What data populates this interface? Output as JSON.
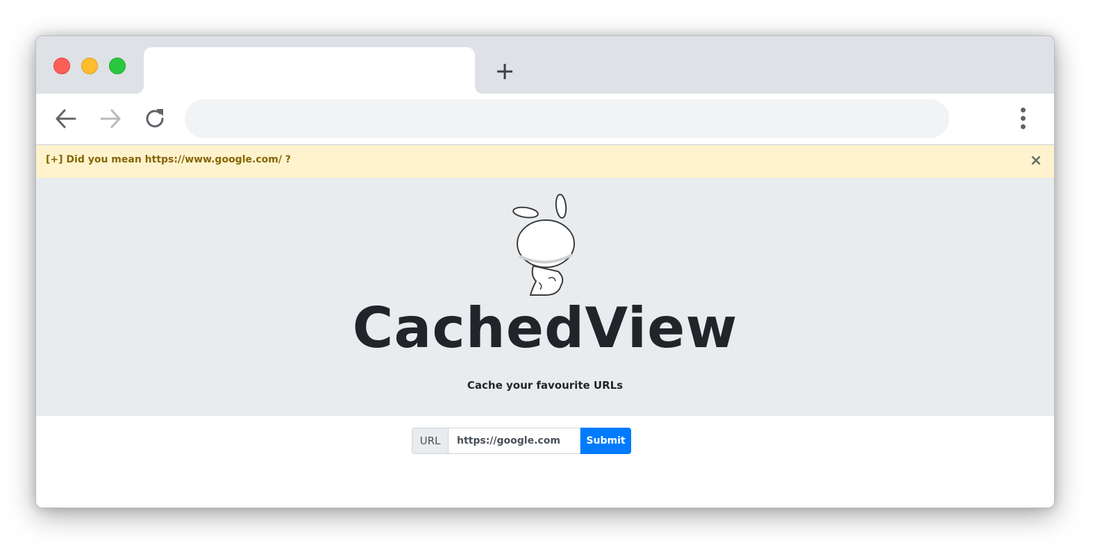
{
  "browser": {
    "tab_title": "",
    "address_value": "",
    "colors": {
      "titlebar": "#dee1e6",
      "omnibox": "#f1f3f4",
      "close": "#ff5f57",
      "minimize": "#febc2e",
      "maximize": "#28c840"
    },
    "icons": [
      "back-arrow-icon",
      "forward-arrow-icon",
      "reload-icon",
      "plus-icon",
      "kebab-menu-icon"
    ]
  },
  "alert": {
    "text": "[+] Did you mean https://www.google.com/ ?",
    "close_glyph": "×",
    "color": "#856404",
    "background": "#fff3cd"
  },
  "hero": {
    "title": "CachedView",
    "subtitle": "Cache your favourite URLs",
    "mascot": "bunny-mascot-image"
  },
  "form": {
    "label": "URL",
    "url_value": "https://google.com",
    "submit_label": "Submit",
    "accent": "#007bff"
  }
}
